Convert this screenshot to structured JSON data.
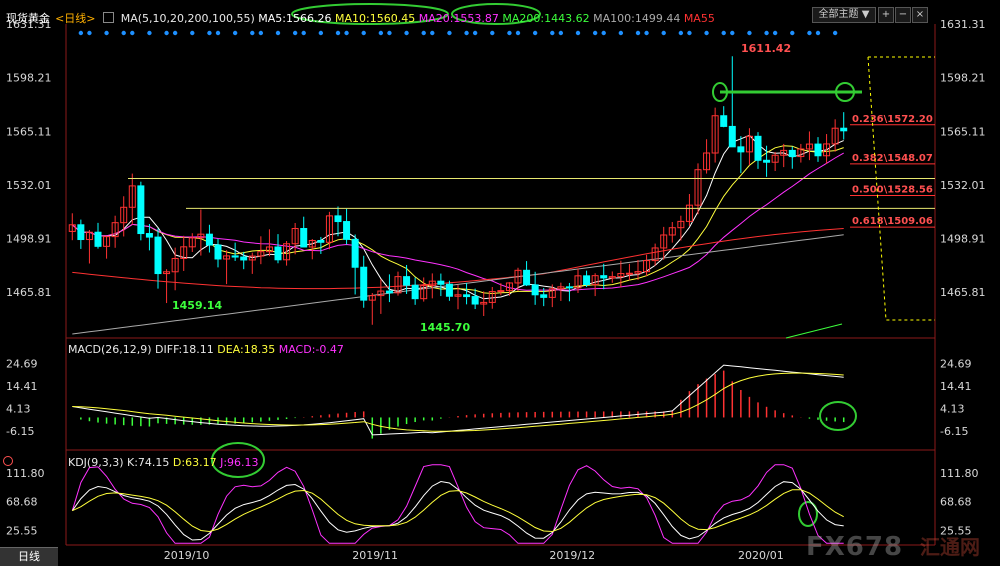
{
  "instrument": "现货黄金",
  "period_selector": "<日线>",
  "ma_legend": [
    {
      "key": "ma_params",
      "text": "MA(5,10,20,200,100,55)",
      "color": "#e8e8e8"
    },
    {
      "key": "ma5",
      "text": "MA5:1566.26",
      "color": "#ffffff"
    },
    {
      "key": "ma10",
      "text": "MA10:1560.45",
      "color": "#ffff3c"
    },
    {
      "key": "ma20",
      "text": "MA20:1553.87",
      "color": "#ff32ff"
    },
    {
      "key": "ma200",
      "text": "MA200:1443.62",
      "color": "#3cff3c"
    },
    {
      "key": "ma100",
      "text": "MA100:1499.44",
      "color": "#aaaaaa"
    },
    {
      "key": "ma55",
      "text": "MA55",
      "color": "#ff3232"
    }
  ],
  "toolbar": {
    "theme_label": "全部主题",
    "close_label": "×"
  },
  "price_axis": [
    "1631.31",
    "1598.21",
    "1565.11",
    "1532.01",
    "1498.91",
    "1465.81"
  ],
  "price_labels": {
    "high": "1611.42",
    "low1": "1459.14",
    "low2": "1445.70"
  },
  "fib_levels": [
    "0.236\\1572.20",
    "0.382\\1548.07",
    "0.500\\1528.56",
    "0.618\\1509.06"
  ],
  "macd_legend": {
    "title": "MACD(26,12,9)",
    "diff": "DIFF:18.11",
    "dea": "DEA:18.35",
    "macd": "MACD:-0.47"
  },
  "macd_axis": [
    "24.69",
    "14.41",
    "4.13",
    "-6.15"
  ],
  "kdj_legend": {
    "title": "KDJ(9,3,3)",
    "k": "K:74.15",
    "d": "D:63.17",
    "j": "J:96.13"
  },
  "kdj_axis": [
    "111.80",
    "68.68",
    "25.55"
  ],
  "date_axis": [
    "2019/10",
    "2019/11",
    "2019/12",
    "2020/01"
  ],
  "timeframe_button": "日线",
  "watermark": "FX678",
  "watermark_cn": "汇通网",
  "colors": {
    "up": "#ff3232",
    "down": "#00ffff",
    "up_fill": "#00ff66",
    "fib": "#ffff00",
    "highlight": "#33cc33"
  },
  "chart_data": {
    "type": "candlestick",
    "ylim": [
      1440,
      1631.31
    ],
    "candles": [
      [
        1503.3,
        1514.5,
        1497.9,
        1507.4
      ],
      [
        1507.4,
        1510.6,
        1492.5,
        1498.3
      ],
      [
        1498.3,
        1504.2,
        1483.5,
        1502.8
      ],
      [
        1502.8,
        1508.6,
        1492.7,
        1494.1
      ],
      [
        1494.1,
        1500.1,
        1486.5,
        1500.1
      ],
      [
        1500.1,
        1513.0,
        1493.2,
        1508.7
      ],
      [
        1508.7,
        1525.0,
        1500.2,
        1518.2
      ],
      [
        1518.2,
        1539.0,
        1507.5,
        1531.4
      ],
      [
        1531.4,
        1534.0,
        1497.8,
        1502.0
      ],
      [
        1502.0,
        1507.9,
        1491.6,
        1499.8
      ],
      [
        1499.8,
        1505.1,
        1468.0,
        1477.3
      ],
      [
        1477.3,
        1480.0,
        1459.1,
        1478.4
      ],
      [
        1478.4,
        1493.3,
        1467.0,
        1486.6
      ],
      [
        1486.6,
        1500.6,
        1478.9,
        1493.8
      ],
      [
        1493.8,
        1502.2,
        1490.6,
        1499.3
      ],
      [
        1499.3,
        1516.8,
        1488.4,
        1501.6
      ],
      [
        1501.6,
        1507.4,
        1490.3,
        1494.9
      ],
      [
        1494.9,
        1498.6,
        1481.1,
        1486.3
      ],
      [
        1486.3,
        1491.7,
        1470.8,
        1488.2
      ],
      [
        1488.2,
        1496.4,
        1485.1,
        1487.5
      ],
      [
        1487.5,
        1490.7,
        1480.0,
        1485.7
      ],
      [
        1485.7,
        1490.2,
        1477.1,
        1488.1
      ],
      [
        1488.1,
        1500.3,
        1483.1,
        1490.8
      ],
      [
        1490.8,
        1504.6,
        1488.0,
        1493.7
      ],
      [
        1493.7,
        1501.6,
        1483.7,
        1485.8
      ],
      [
        1485.8,
        1497.4,
        1482.2,
        1495.7
      ],
      [
        1495.7,
        1508.5,
        1489.2,
        1505.1
      ],
      [
        1505.1,
        1512.4,
        1494.6,
        1493.7
      ],
      [
        1493.7,
        1498.6,
        1486.1,
        1497.7
      ],
      [
        1497.7,
        1499.9,
        1489.4,
        1496.6
      ],
      [
        1496.6,
        1515.4,
        1492.3,
        1512.9
      ],
      [
        1512.9,
        1518.7,
        1500.3,
        1509.4
      ],
      [
        1509.4,
        1517.2,
        1495.2,
        1498.4
      ],
      [
        1498.4,
        1501.4,
        1464.4,
        1481.2
      ],
      [
        1481.2,
        1488.3,
        1456.2,
        1460.9
      ],
      [
        1460.9,
        1465.3,
        1445.7,
        1463.7
      ],
      [
        1463.7,
        1473.8,
        1452.4,
        1466.5
      ],
      [
        1466.5,
        1476.8,
        1459.7,
        1465.4
      ],
      [
        1465.4,
        1478.5,
        1463.7,
        1475.4
      ],
      [
        1475.4,
        1482.6,
        1464.7,
        1470.1
      ],
      [
        1470.1,
        1474.9,
        1458.0,
        1461.8
      ],
      [
        1461.8,
        1474.9,
        1460.0,
        1469.9
      ],
      [
        1469.9,
        1477.4,
        1462.0,
        1472.6
      ],
      [
        1472.6,
        1477.3,
        1463.4,
        1470.7
      ],
      [
        1470.7,
        1472.9,
        1460.5,
        1463.3
      ],
      [
        1463.3,
        1470.3,
        1455.3,
        1464.2
      ],
      [
        1464.2,
        1471.4,
        1458.3,
        1463.1
      ],
      [
        1463.1,
        1468.0,
        1455.4,
        1458.5
      ],
      [
        1458.5,
        1466.3,
        1451.1,
        1459.5
      ],
      [
        1459.5,
        1469.0,
        1455.6,
        1466.2
      ],
      [
        1466.2,
        1471.4,
        1463.9,
        1466.8
      ],
      [
        1466.8,
        1472.0,
        1463.6,
        1471.5
      ],
      [
        1471.5,
        1480.9,
        1466.5,
        1479.3
      ],
      [
        1479.3,
        1485.0,
        1469.6,
        1470.3
      ],
      [
        1470.3,
        1478.4,
        1458.0,
        1464.2
      ],
      [
        1464.2,
        1468.4,
        1457.2,
        1462.6
      ],
      [
        1462.6,
        1470.6,
        1456.6,
        1467.9
      ],
      [
        1467.9,
        1471.7,
        1460.4,
        1469.1
      ],
      [
        1469.1,
        1471.5,
        1460.2,
        1468.5
      ],
      [
        1468.5,
        1480.5,
        1465.3,
        1475.9
      ],
      [
        1475.9,
        1479.1,
        1469.0,
        1470.5
      ],
      [
        1470.5,
        1477.5,
        1463.4,
        1476.0
      ],
      [
        1476.0,
        1483.3,
        1467.6,
        1474.6
      ],
      [
        1474.6,
        1478.6,
        1471.6,
        1475.4
      ],
      [
        1475.4,
        1485.2,
        1468.7,
        1477.3
      ],
      [
        1477.3,
        1483.3,
        1473.1,
        1477.5
      ],
      [
        1477.5,
        1485.7,
        1473.3,
        1478.5
      ],
      [
        1478.5,
        1488.9,
        1475.7,
        1485.3
      ],
      [
        1485.3,
        1495.8,
        1482.1,
        1493.1
      ],
      [
        1493.1,
        1506.1,
        1485.8,
        1501.1
      ],
      [
        1501.1,
        1509.1,
        1496.4,
        1505.6
      ],
      [
        1505.6,
        1513.0,
        1497.7,
        1509.5
      ],
      [
        1509.5,
        1526.4,
        1506.6,
        1519.5
      ],
      [
        1519.5,
        1545.3,
        1513.9,
        1541.4
      ],
      [
        1541.4,
        1560.2,
        1539.0,
        1551.7
      ],
      [
        1551.7,
        1579.7,
        1545.8,
        1574.7
      ],
      [
        1574.7,
        1580.6,
        1567.6,
        1568.1
      ],
      [
        1568.1,
        1611.4,
        1564.0,
        1555.5
      ],
      [
        1555.5,
        1562.1,
        1539.3,
        1552.4
      ],
      [
        1552.4,
        1567.0,
        1544.2,
        1562.0
      ],
      [
        1562.0,
        1564.6,
        1541.9,
        1547.2
      ],
      [
        1547.2,
        1556.2,
        1537.0,
        1546.0
      ],
      [
        1546.0,
        1552.3,
        1540.6,
        1550.3
      ],
      [
        1550.3,
        1557.3,
        1543.0,
        1553.3
      ],
      [
        1553.3,
        1555.7,
        1542.0,
        1549.5
      ],
      [
        1549.5,
        1557.3,
        1545.8,
        1554.2
      ],
      [
        1554.2,
        1565.0,
        1547.3,
        1557.2
      ],
      [
        1557.2,
        1561.5,
        1546.2,
        1550.0
      ],
      [
        1550.0,
        1563.4,
        1545.1,
        1557.3
      ],
      [
        1557.3,
        1572.5,
        1552.5,
        1567.0
      ],
      [
        1567.0,
        1576.9,
        1560.0,
        1565.4
      ]
    ],
    "fib": [
      1572.2,
      1548.07,
      1528.56,
      1509.06
    ],
    "macd_ylim": [
      -14,
      30
    ],
    "kdj_ylim": [
      5,
      125
    ],
    "dates": [
      "2019/10",
      "2019/11",
      "2019/12",
      "2020/01"
    ]
  }
}
